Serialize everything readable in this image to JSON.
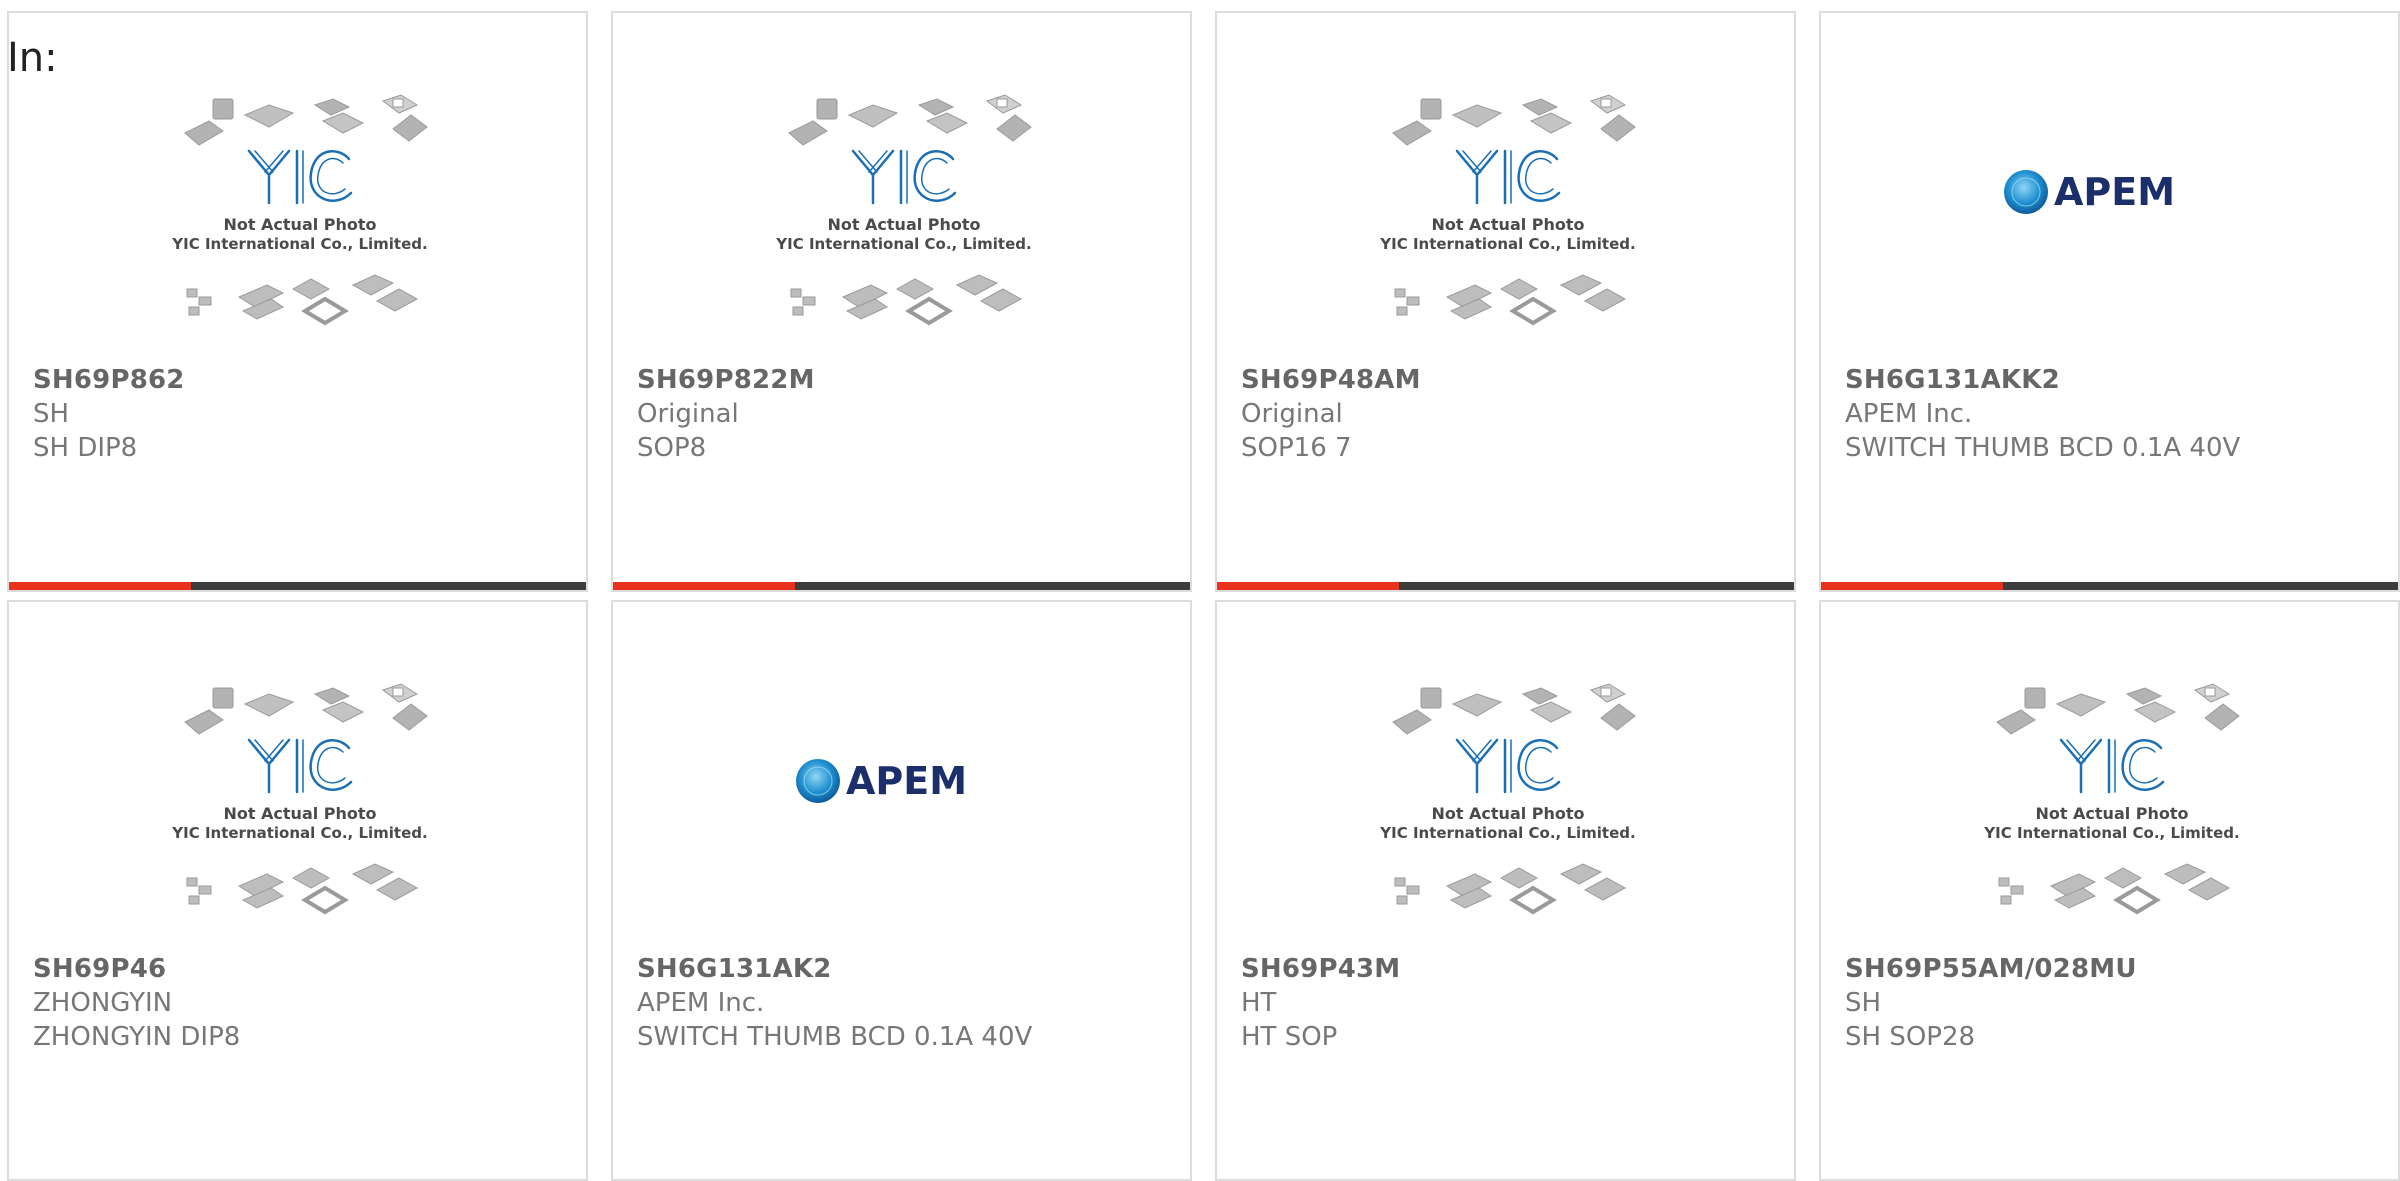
{
  "header": {
    "prefix": "In:"
  },
  "placeholder": {
    "brand": "YIC",
    "note_line1": "Not Actual Photo",
    "note_line2": "YIC International Co., Limited."
  },
  "apem_logo": {
    "text": "APEM"
  },
  "products": [
    {
      "part": "SH69P862",
      "manufacturer": "SH",
      "description": "SH DIP8",
      "image": "yic-placeholder"
    },
    {
      "part": "SH69P822M",
      "manufacturer": "Original",
      "description": "SOP8",
      "image": "yic-placeholder"
    },
    {
      "part": "SH69P48AM",
      "manufacturer": "Original",
      "description": "SOP16 7",
      "image": "yic-placeholder"
    },
    {
      "part": "SH6G131AKK2",
      "manufacturer": "APEM Inc.",
      "description": "SWITCH THUMB BCD 0.1A 40V",
      "image": "apem-logo"
    },
    {
      "part": "SH69P46",
      "manufacturer": "ZHONGYIN",
      "description": "ZHONGYIN DIP8",
      "image": "yic-placeholder"
    },
    {
      "part": "SH6G131AK2",
      "manufacturer": "APEM Inc.",
      "description": "SWITCH THUMB BCD 0.1A 40V",
      "image": "apem-logo"
    },
    {
      "part": "SH69P43M",
      "manufacturer": "HT",
      "description": "HT SOP",
      "image": "yic-placeholder"
    },
    {
      "part": "SH69P55AM/028MU",
      "manufacturer": "SH",
      "description": "SH SOP28",
      "image": "yic-placeholder"
    }
  ],
  "colors": {
    "accent": "#e8321e",
    "bar": "#3d3d3d",
    "brand_blue": "#1a6fb5",
    "apem_navy": "#1b2f6b"
  }
}
